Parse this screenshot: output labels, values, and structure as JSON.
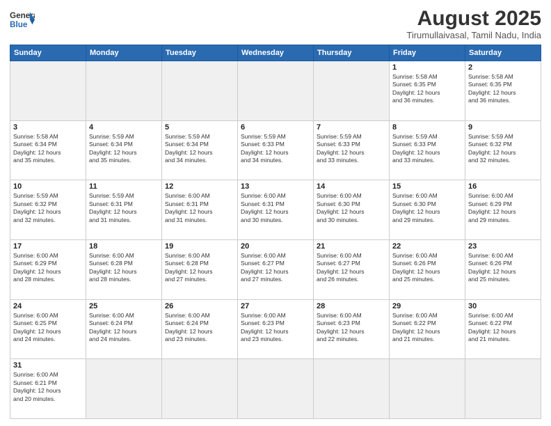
{
  "header": {
    "logo_general": "General",
    "logo_blue": "Blue",
    "title": "August 2025",
    "subtitle": "Tirumullaivasal, Tamil Nadu, India"
  },
  "weekdays": [
    "Sunday",
    "Monday",
    "Tuesday",
    "Wednesday",
    "Thursday",
    "Friday",
    "Saturday"
  ],
  "weeks": [
    [
      {
        "day": "",
        "info": "",
        "empty": true
      },
      {
        "day": "",
        "info": "",
        "empty": true
      },
      {
        "day": "",
        "info": "",
        "empty": true
      },
      {
        "day": "",
        "info": "",
        "empty": true
      },
      {
        "day": "",
        "info": "",
        "empty": true
      },
      {
        "day": "1",
        "info": "Sunrise: 5:58 AM\nSunset: 6:35 PM\nDaylight: 12 hours\nand 36 minutes."
      },
      {
        "day": "2",
        "info": "Sunrise: 5:58 AM\nSunset: 6:35 PM\nDaylight: 12 hours\nand 36 minutes."
      }
    ],
    [
      {
        "day": "3",
        "info": "Sunrise: 5:58 AM\nSunset: 6:34 PM\nDaylight: 12 hours\nand 35 minutes."
      },
      {
        "day": "4",
        "info": "Sunrise: 5:59 AM\nSunset: 6:34 PM\nDaylight: 12 hours\nand 35 minutes."
      },
      {
        "day": "5",
        "info": "Sunrise: 5:59 AM\nSunset: 6:34 PM\nDaylight: 12 hours\nand 34 minutes."
      },
      {
        "day": "6",
        "info": "Sunrise: 5:59 AM\nSunset: 6:33 PM\nDaylight: 12 hours\nand 34 minutes."
      },
      {
        "day": "7",
        "info": "Sunrise: 5:59 AM\nSunset: 6:33 PM\nDaylight: 12 hours\nand 33 minutes."
      },
      {
        "day": "8",
        "info": "Sunrise: 5:59 AM\nSunset: 6:33 PM\nDaylight: 12 hours\nand 33 minutes."
      },
      {
        "day": "9",
        "info": "Sunrise: 5:59 AM\nSunset: 6:32 PM\nDaylight: 12 hours\nand 32 minutes."
      }
    ],
    [
      {
        "day": "10",
        "info": "Sunrise: 5:59 AM\nSunset: 6:32 PM\nDaylight: 12 hours\nand 32 minutes."
      },
      {
        "day": "11",
        "info": "Sunrise: 5:59 AM\nSunset: 6:31 PM\nDaylight: 12 hours\nand 31 minutes."
      },
      {
        "day": "12",
        "info": "Sunrise: 6:00 AM\nSunset: 6:31 PM\nDaylight: 12 hours\nand 31 minutes."
      },
      {
        "day": "13",
        "info": "Sunrise: 6:00 AM\nSunset: 6:31 PM\nDaylight: 12 hours\nand 30 minutes."
      },
      {
        "day": "14",
        "info": "Sunrise: 6:00 AM\nSunset: 6:30 PM\nDaylight: 12 hours\nand 30 minutes."
      },
      {
        "day": "15",
        "info": "Sunrise: 6:00 AM\nSunset: 6:30 PM\nDaylight: 12 hours\nand 29 minutes."
      },
      {
        "day": "16",
        "info": "Sunrise: 6:00 AM\nSunset: 6:29 PM\nDaylight: 12 hours\nand 29 minutes."
      }
    ],
    [
      {
        "day": "17",
        "info": "Sunrise: 6:00 AM\nSunset: 6:29 PM\nDaylight: 12 hours\nand 28 minutes."
      },
      {
        "day": "18",
        "info": "Sunrise: 6:00 AM\nSunset: 6:28 PM\nDaylight: 12 hours\nand 28 minutes."
      },
      {
        "day": "19",
        "info": "Sunrise: 6:00 AM\nSunset: 6:28 PM\nDaylight: 12 hours\nand 27 minutes."
      },
      {
        "day": "20",
        "info": "Sunrise: 6:00 AM\nSunset: 6:27 PM\nDaylight: 12 hours\nand 27 minutes."
      },
      {
        "day": "21",
        "info": "Sunrise: 6:00 AM\nSunset: 6:27 PM\nDaylight: 12 hours\nand 26 minutes."
      },
      {
        "day": "22",
        "info": "Sunrise: 6:00 AM\nSunset: 6:26 PM\nDaylight: 12 hours\nand 25 minutes."
      },
      {
        "day": "23",
        "info": "Sunrise: 6:00 AM\nSunset: 6:26 PM\nDaylight: 12 hours\nand 25 minutes."
      }
    ],
    [
      {
        "day": "24",
        "info": "Sunrise: 6:00 AM\nSunset: 6:25 PM\nDaylight: 12 hours\nand 24 minutes."
      },
      {
        "day": "25",
        "info": "Sunrise: 6:00 AM\nSunset: 6:24 PM\nDaylight: 12 hours\nand 24 minutes."
      },
      {
        "day": "26",
        "info": "Sunrise: 6:00 AM\nSunset: 6:24 PM\nDaylight: 12 hours\nand 23 minutes."
      },
      {
        "day": "27",
        "info": "Sunrise: 6:00 AM\nSunset: 6:23 PM\nDaylight: 12 hours\nand 23 minutes."
      },
      {
        "day": "28",
        "info": "Sunrise: 6:00 AM\nSunset: 6:23 PM\nDaylight: 12 hours\nand 22 minutes."
      },
      {
        "day": "29",
        "info": "Sunrise: 6:00 AM\nSunset: 6:22 PM\nDaylight: 12 hours\nand 21 minutes."
      },
      {
        "day": "30",
        "info": "Sunrise: 6:00 AM\nSunset: 6:22 PM\nDaylight: 12 hours\nand 21 minutes."
      }
    ],
    [
      {
        "day": "31",
        "info": "Sunrise: 6:00 AM\nSunset: 6:21 PM\nDaylight: 12 hours\nand 20 minutes."
      },
      {
        "day": "",
        "info": "",
        "empty": true
      },
      {
        "day": "",
        "info": "",
        "empty": true
      },
      {
        "day": "",
        "info": "",
        "empty": true
      },
      {
        "day": "",
        "info": "",
        "empty": true
      },
      {
        "day": "",
        "info": "",
        "empty": true
      },
      {
        "day": "",
        "info": "",
        "empty": true
      }
    ]
  ]
}
